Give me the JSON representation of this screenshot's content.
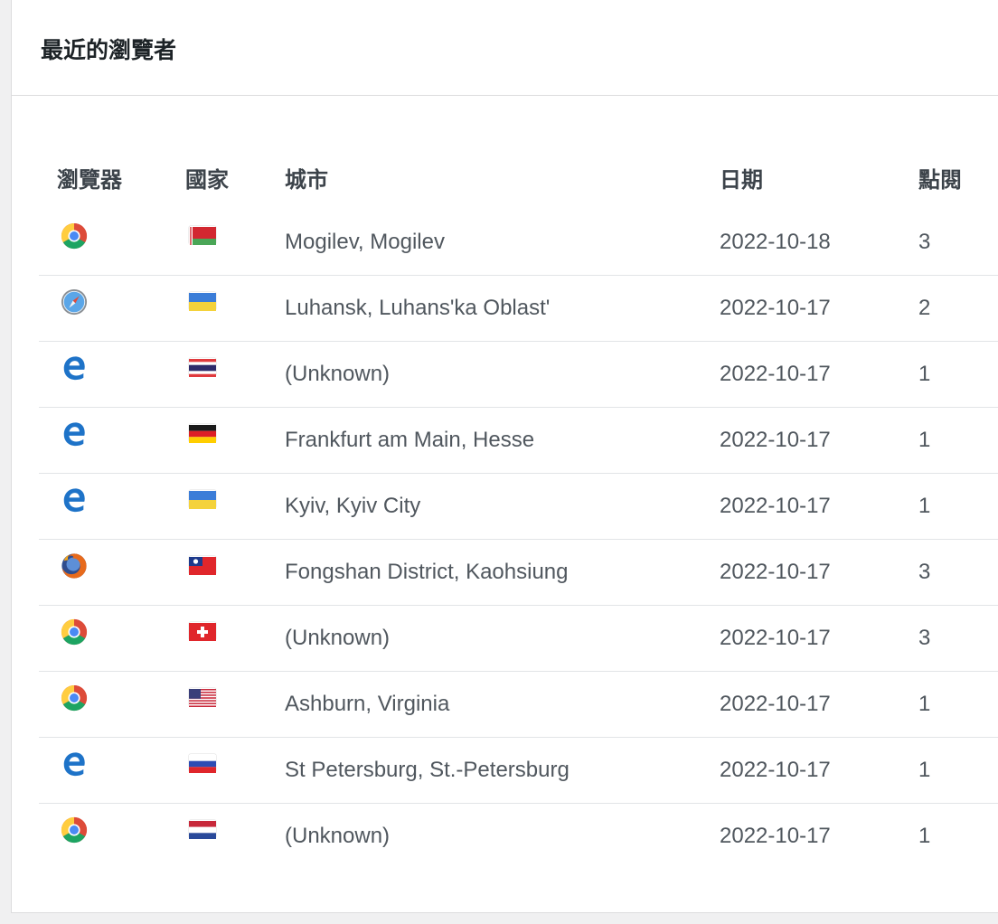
{
  "widget": {
    "title": "最近的瀏覽者"
  },
  "columns": {
    "browser": "瀏覽器",
    "country": "國家",
    "city": "城市",
    "date": "日期",
    "hits": "點閱"
  },
  "rows": [
    {
      "browser": "chrome-icon",
      "flag": "belarus-flag-icon",
      "city": "Mogilev, Mogilev",
      "date": "2022-10-18",
      "hits": "3"
    },
    {
      "browser": "safari-icon",
      "flag": "ukraine-flag-icon",
      "city": "Luhansk, Luhans'ka Oblast'",
      "date": "2022-10-17",
      "hits": "2"
    },
    {
      "browser": "edge-icon",
      "flag": "thailand-flag-icon",
      "city": "(Unknown)",
      "date": "2022-10-17",
      "hits": "1"
    },
    {
      "browser": "edge-icon",
      "flag": "germany-flag-icon",
      "city": "Frankfurt am Main, Hesse",
      "date": "2022-10-17",
      "hits": "1"
    },
    {
      "browser": "edge-icon",
      "flag": "ukraine-flag-icon",
      "city": "Kyiv, Kyiv City",
      "date": "2022-10-17",
      "hits": "1"
    },
    {
      "browser": "firefox-icon",
      "flag": "taiwan-flag-icon",
      "city": "Fongshan District, Kaohsiung",
      "date": "2022-10-17",
      "hits": "3"
    },
    {
      "browser": "chrome-icon",
      "flag": "switzerland-flag-icon",
      "city": "(Unknown)",
      "date": "2022-10-17",
      "hits": "3"
    },
    {
      "browser": "chrome-icon",
      "flag": "usa-flag-icon",
      "city": "Ashburn, Virginia",
      "date": "2022-10-17",
      "hits": "1"
    },
    {
      "browser": "edge-icon",
      "flag": "russia-flag-icon",
      "city": "St Petersburg, St.-Petersburg",
      "date": "2022-10-17",
      "hits": "1"
    },
    {
      "browser": "chrome-icon",
      "flag": "netherlands-flag-icon",
      "city": "(Unknown)",
      "date": "2022-10-17",
      "hits": "1"
    }
  ]
}
